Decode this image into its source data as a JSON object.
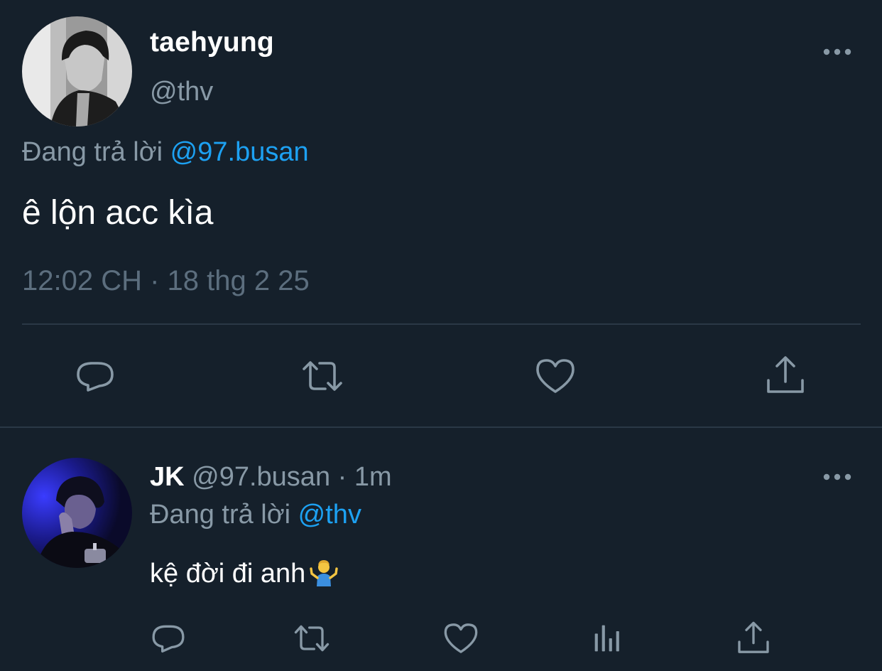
{
  "colors": {
    "background": "#15202b",
    "primary_text": "#ffffff",
    "secondary_text": "#8899a6",
    "accent": "#1da1f2",
    "divider": "#2a3846"
  },
  "main_tweet": {
    "author_name": "taehyung",
    "author_handle": "@thv",
    "replying_prefix": "Đang trả lời",
    "replying_to": "@97.busan",
    "text": "ê lộn acc kìa",
    "timestamp": "12:02 CH · 18 thg 2 25",
    "more_icon": "more-horizontal-icon",
    "actions": [
      "reply-icon",
      "retweet-icon",
      "like-icon",
      "share-icon"
    ]
  },
  "reply_tweet": {
    "author_name": "JK",
    "author_handle": "@97.busan",
    "separator": "·",
    "time_ago": "1m",
    "replying_prefix": "Đang trả lời",
    "replying_to": "@thv",
    "text": "kệ đời đi anh",
    "emoji": "person-shrugging-emoji",
    "more_icon": "more-horizontal-icon",
    "actions": [
      "reply-icon",
      "retweet-icon",
      "like-icon",
      "stats-icon",
      "share-icon"
    ]
  }
}
